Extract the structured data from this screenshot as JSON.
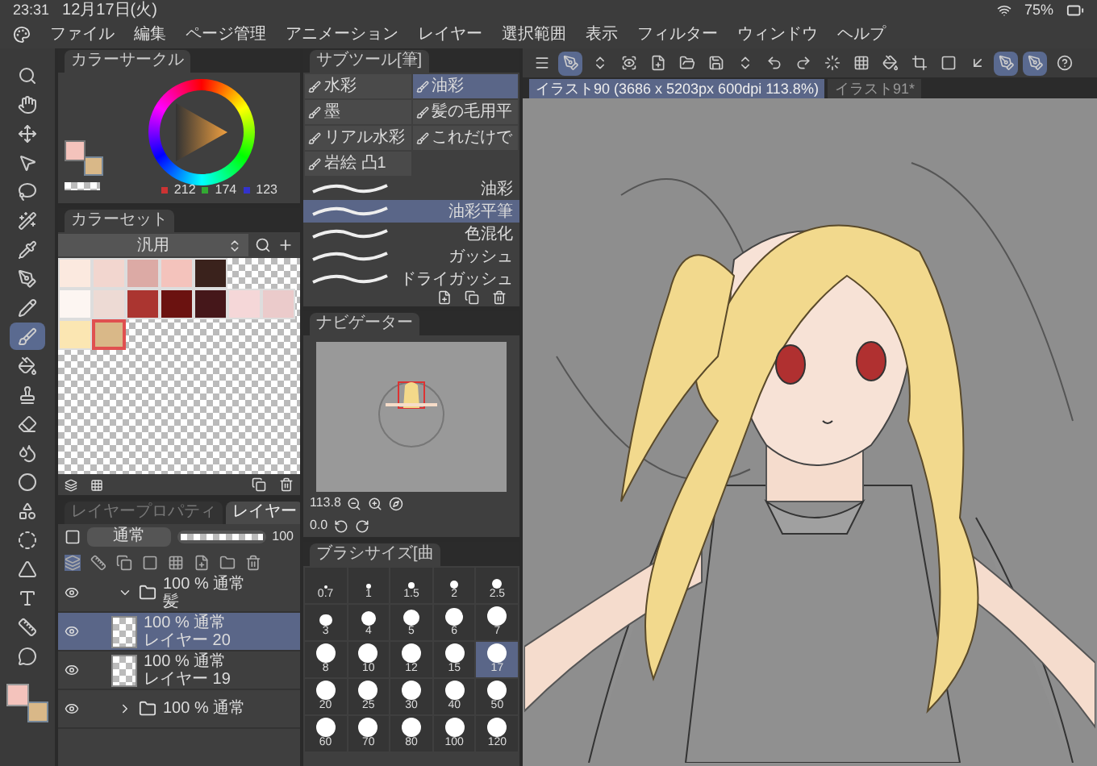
{
  "status_bar": {
    "time": "23:31",
    "date": "12月17日(火)",
    "battery": "75%"
  },
  "menu": [
    "ファイル",
    "編集",
    "ページ管理",
    "アニメーション",
    "レイヤー",
    "選択範囲",
    "表示",
    "フィルター",
    "ウィンドウ",
    "ヘルプ"
  ],
  "tools": [
    {
      "kind": "magnifier",
      "selected": false
    },
    {
      "kind": "hand",
      "selected": false
    },
    {
      "kind": "move",
      "selected": false
    },
    {
      "kind": "pointer",
      "selected": false
    },
    {
      "kind": "lasso",
      "selected": false
    },
    {
      "kind": "wand",
      "selected": false
    },
    {
      "kind": "eyedropper",
      "selected": false
    },
    {
      "kind": "pen",
      "selected": false
    },
    {
      "kind": "pencil",
      "selected": false
    },
    {
      "kind": "brush",
      "selected": true
    },
    {
      "kind": "bucket",
      "selected": false
    },
    {
      "kind": "stamp",
      "selected": false
    },
    {
      "kind": "eraser",
      "selected": false
    },
    {
      "kind": "droplets",
      "selected": false
    },
    {
      "kind": "circle",
      "selected": false
    },
    {
      "kind": "shapes",
      "selected": false
    },
    {
      "kind": "ring",
      "selected": false
    },
    {
      "kind": "triangle",
      "selected": false
    },
    {
      "kind": "text",
      "selected": false
    },
    {
      "kind": "ruler",
      "selected": false
    },
    {
      "kind": "balloon",
      "selected": false
    }
  ],
  "main_colors": [
    {
      "color": "#f4c3bc"
    },
    {
      "color": "#d9b888"
    }
  ],
  "color_circle": {
    "title": "カラーサークル",
    "r": "212",
    "g": "174",
    "b": "123"
  },
  "color_set": {
    "title": "カラーセット",
    "set_name": "汎用",
    "rows": [
      [
        {
          "color": "#fbe9df",
          "selected": false
        },
        {
          "color": "#f2d6cf",
          "selected": false
        },
        {
          "color": "#dcaaa5",
          "selected": false
        },
        {
          "color": "#f4c3bc",
          "selected": false
        },
        {
          "color": "#3a221c",
          "selected": false
        }
      ],
      [
        {
          "color": "#fdf6f2",
          "selected": false
        },
        {
          "color": "#eddad4",
          "selected": false
        },
        {
          "color": "#ab3530",
          "selected": false
        },
        {
          "color": "#6b1210",
          "selected": false
        },
        {
          "color": "#45171a",
          "selected": false
        },
        {
          "color": "#f5d7d8",
          "selected": false
        },
        {
          "color": "#ebcbcb",
          "selected": false
        }
      ],
      [
        {
          "color": "#fbe6b2",
          "selected": false
        },
        {
          "color": "#d9b888",
          "selected": true
        }
      ]
    ]
  },
  "layer_panel": {
    "tabs": [
      {
        "label": "レイヤープロパティ",
        "selected": false
      },
      {
        "label": "レイヤー",
        "selected": true
      }
    ],
    "blend_mode": "通常",
    "opacity": "100",
    "opacity_slider": {
      "level": 1
    },
    "layers": [
      {
        "kind": "folder",
        "info": "100 % 通常",
        "name": "髪",
        "expanded": true,
        "selected": false
      },
      {
        "kind": "raster",
        "info": "100 % 通常",
        "name": "レイヤー 20",
        "selected": true
      },
      {
        "kind": "raster",
        "info": "100 % 通常",
        "name": "レイヤー 19",
        "selected": false
      },
      {
        "kind": "folder",
        "info": "100 % 通常",
        "expanded": false,
        "selected": false
      }
    ]
  },
  "sub_tool": {
    "title": "サブツール[筆]",
    "tools": [
      {
        "label": "水彩",
        "selected": false
      },
      {
        "label": "油彩",
        "selected": true
      },
      {
        "label": "墨",
        "selected": false
      },
      {
        "label": "髪の毛用平",
        "selected": false
      },
      {
        "label": "リアル水彩",
        "selected": false
      },
      {
        "label": "これだけで",
        "selected": false
      },
      {
        "label": "岩絵 凸1",
        "selected": false
      }
    ],
    "brushes": [
      {
        "label": "油彩",
        "selected": false
      },
      {
        "label": "油彩平筆",
        "selected": true
      },
      {
        "label": "色混化",
        "selected": false
      },
      {
        "label": "ガッシュ",
        "selected": false
      },
      {
        "label": "ドライガッシュ",
        "selected": false
      }
    ]
  },
  "navigator": {
    "title": "ナビゲーター",
    "zoom": "113.8",
    "rotation": "0.0"
  },
  "brush_size": {
    "title": "ブラシサイズ[曲",
    "sizes": [
      {
        "label": "0.7",
        "selected": false
      },
      {
        "label": "1",
        "selected": false
      },
      {
        "label": "1.5",
        "selected": false
      },
      {
        "label": "2",
        "selected": false
      },
      {
        "label": "2.5",
        "selected": false
      },
      {
        "label": "3",
        "selected": false
      },
      {
        "label": "4",
        "selected": false
      },
      {
        "label": "5",
        "selected": false
      },
      {
        "label": "6",
        "selected": false
      },
      {
        "label": "7",
        "selected": false
      },
      {
        "label": "8",
        "selected": false
      },
      {
        "label": "10",
        "selected": false
      },
      {
        "label": "12",
        "selected": false
      },
      {
        "label": "15",
        "selected": false
      },
      {
        "label": "17",
        "selected": true
      },
      {
        "label": "20",
        "selected": false
      },
      {
        "label": "25",
        "selected": false
      },
      {
        "label": "30",
        "selected": false
      },
      {
        "label": "40",
        "selected": false
      },
      {
        "label": "50",
        "selected": false
      },
      {
        "label": "60",
        "selected": false
      },
      {
        "label": "70",
        "selected": false
      },
      {
        "label": "80",
        "selected": false
      },
      {
        "label": "100",
        "selected": false
      },
      {
        "label": "120",
        "selected": false
      }
    ]
  },
  "canvas": {
    "toolbar": [
      {
        "kind": "menu",
        "selected": false
      },
      {
        "kind": "pen",
        "selected": true
      },
      {
        "kind": "updown",
        "selected": false
      },
      {
        "kind": "eye",
        "selected": false
      },
      {
        "kind": "newfile",
        "selected": false
      },
      {
        "kind": "folder",
        "selected": false
      },
      {
        "kind": "save",
        "selected": false
      },
      {
        "kind": "updown",
        "selected": false
      },
      {
        "kind": "undo",
        "selected": false
      },
      {
        "kind": "redo",
        "selected": false
      },
      {
        "kind": "loader",
        "selected": false
      },
      {
        "kind": "grid",
        "selected": false
      },
      {
        "kind": "bucket",
        "selected": false
      },
      {
        "kind": "crop",
        "selected": false
      },
      {
        "kind": "square",
        "selected": false
      },
      {
        "kind": "arrow",
        "selected": false
      },
      {
        "kind": "pen",
        "selected": true
      },
      {
        "kind": "pen",
        "selected": true
      },
      {
        "kind": "help",
        "selected": false
      }
    ],
    "tabs": [
      {
        "label": "イラスト90 (3686 x 5203px 600dpi 113.8%)",
        "selected": true
      },
      {
        "label": "イラスト91*",
        "selected": false
      }
    ]
  }
}
